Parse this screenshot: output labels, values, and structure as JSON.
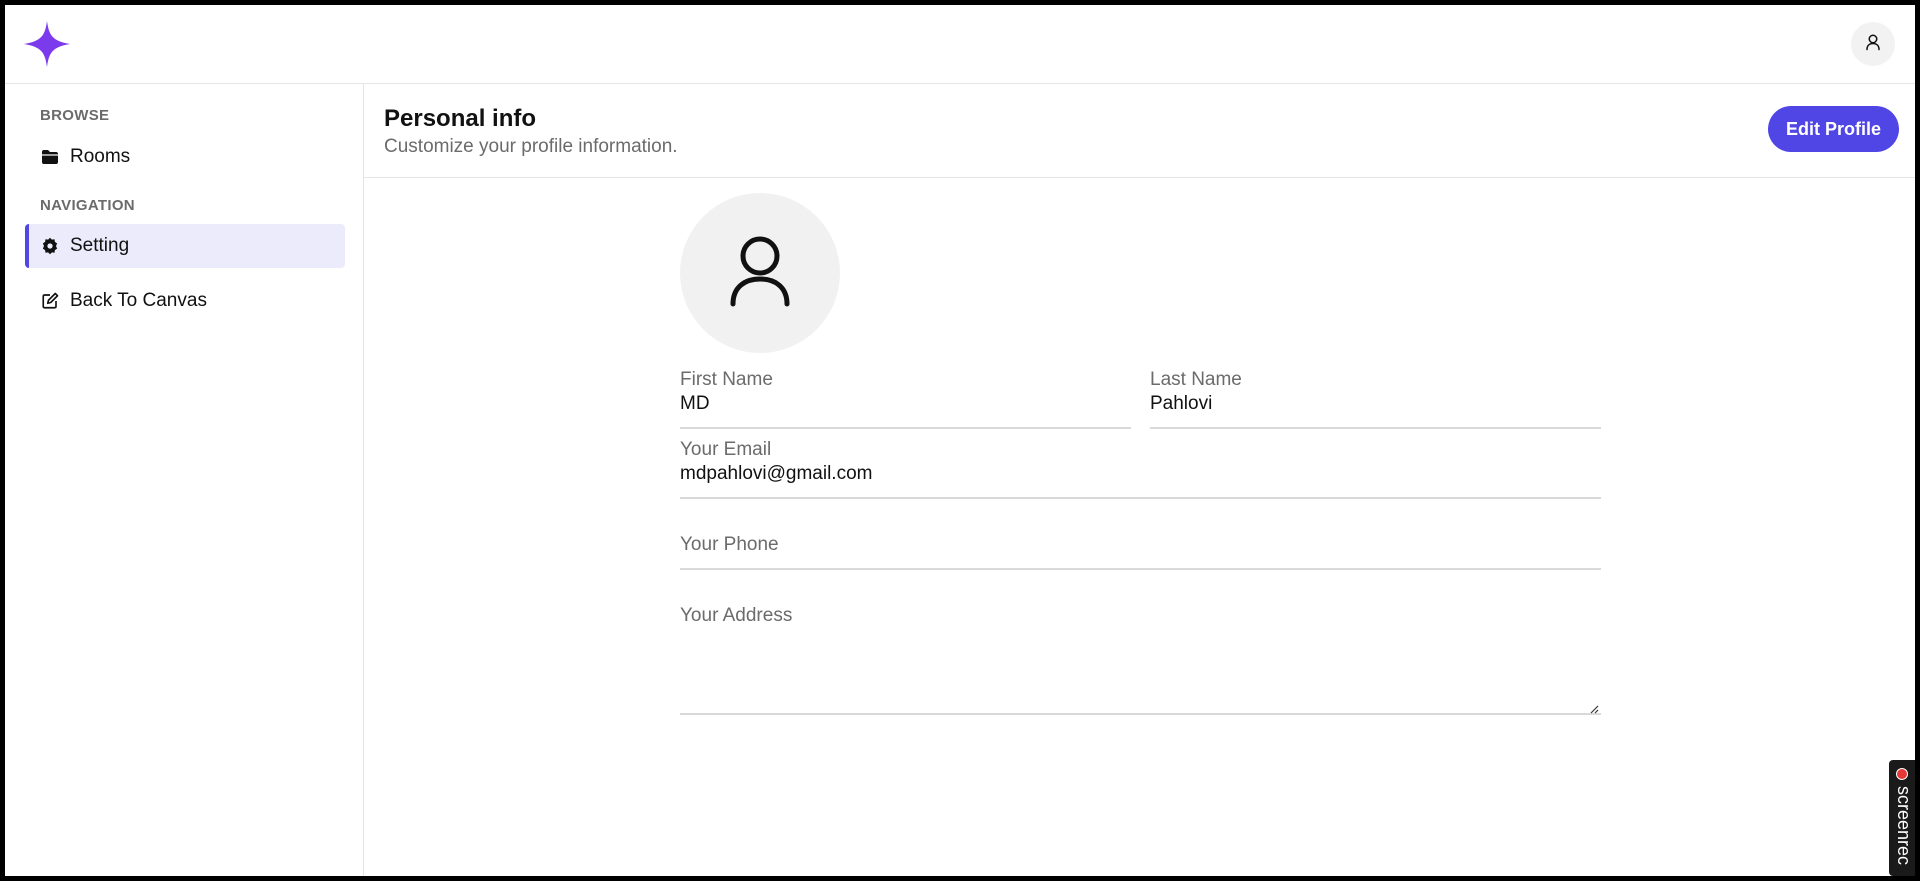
{
  "header": {
    "logo_icon": "sparkle-logo-icon",
    "user_icon": "user-icon"
  },
  "sidebar": {
    "sections": [
      {
        "title": "BROWSE",
        "items": [
          {
            "label": "Rooms",
            "icon": "folder-icon",
            "active": false
          }
        ]
      },
      {
        "title": "NAVIGATION",
        "items": [
          {
            "label": "Setting",
            "icon": "gear-icon",
            "active": true
          },
          {
            "label": "Back To Canvas",
            "icon": "edit-icon",
            "active": false
          }
        ]
      }
    ]
  },
  "main": {
    "title": "Personal info",
    "subtitle": "Customize your profile information.",
    "edit_button_label": "Edit Profile",
    "profile_icon": "user-icon",
    "fields": {
      "first_name": {
        "label": "First Name",
        "value": "MD"
      },
      "last_name": {
        "label": "Last Name",
        "value": "Pahlovi"
      },
      "email": {
        "label": "Your Email",
        "value": "mdpahlovi@gmail.com"
      },
      "phone": {
        "label": "Your Phone",
        "value": ""
      },
      "address": {
        "label": "Your Address",
        "value": ""
      }
    }
  },
  "overlay": {
    "recorder_label": "screenrec"
  },
  "colors": {
    "accent": "#4f46e5",
    "brand": "#6d28d9",
    "active_bg": "#ecebfb"
  }
}
